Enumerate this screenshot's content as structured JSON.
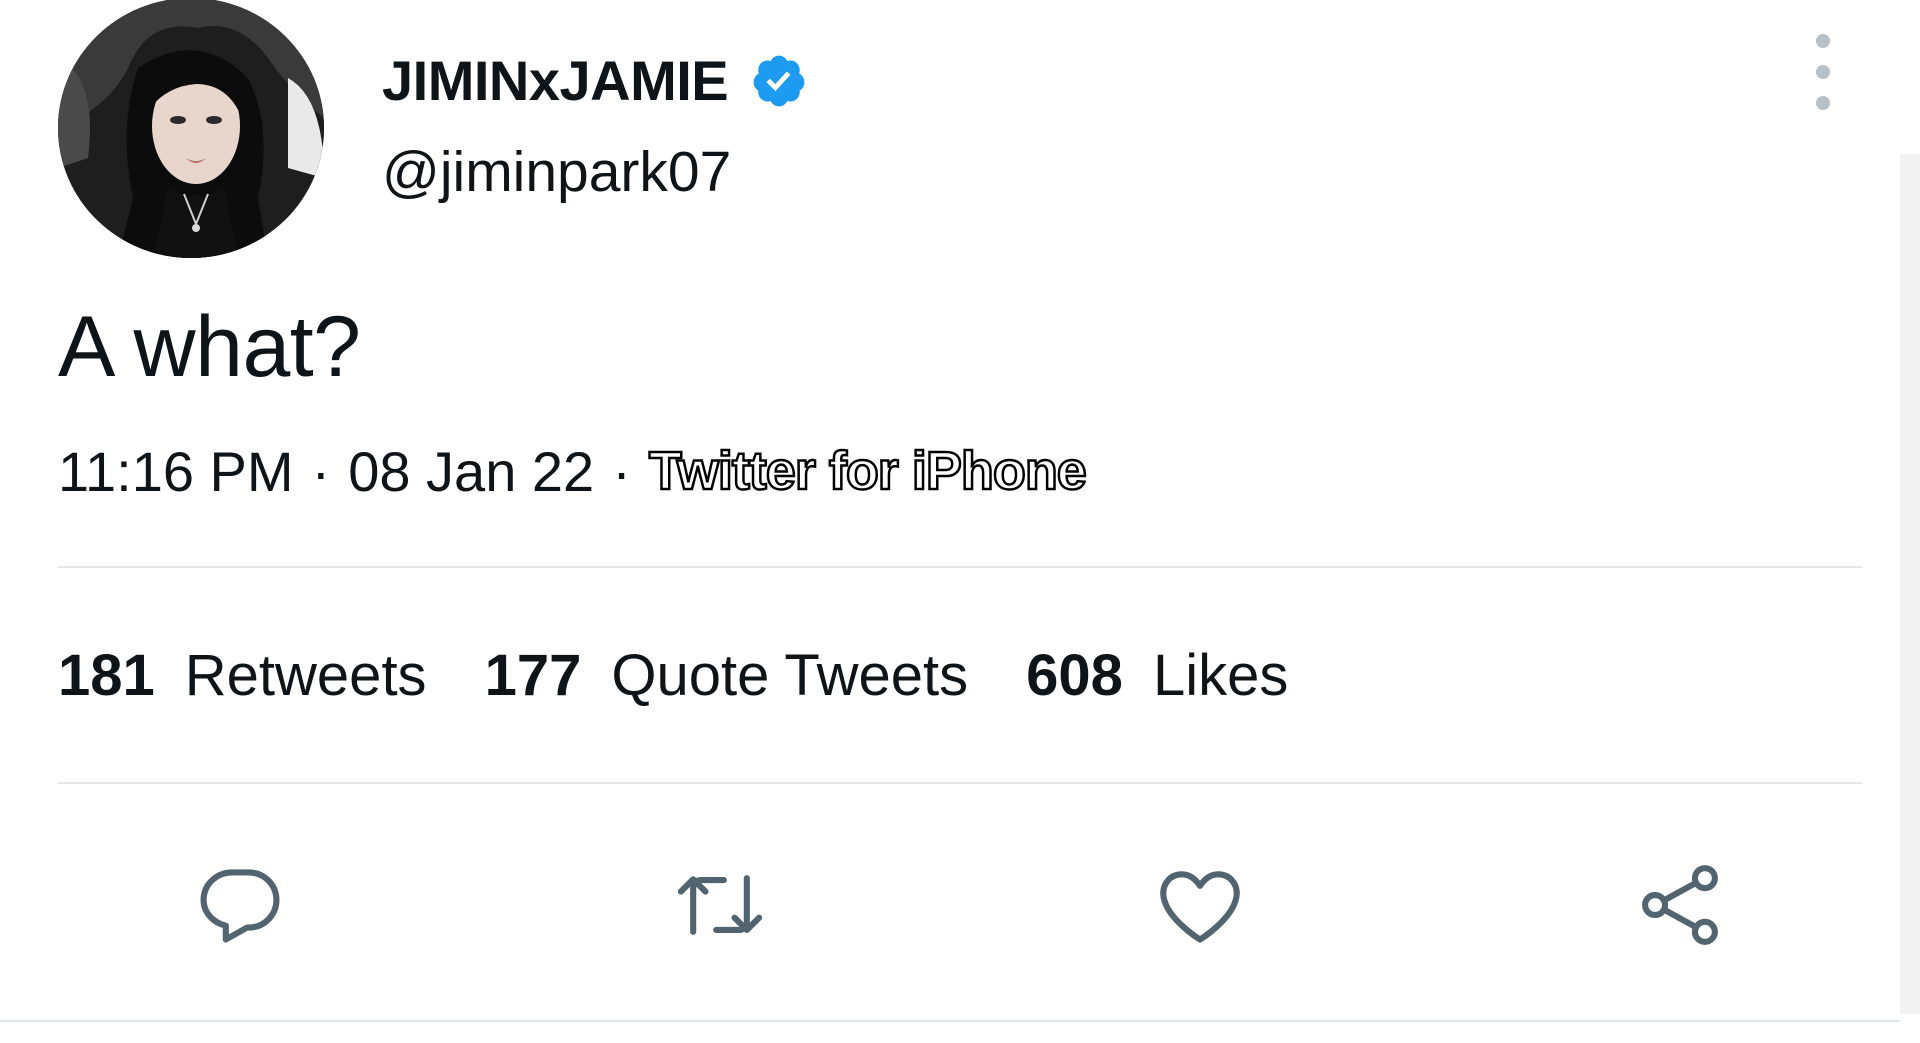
{
  "user": {
    "display_name": "JIMINxJAMIE",
    "handle": "@jiminpark07",
    "verified": true,
    "verified_color": "#1d9bf0"
  },
  "tweet": {
    "text": "A what?",
    "time": "11:16 PM",
    "date": "08 Jan 22",
    "separator": "·",
    "source": "Twitter for iPhone"
  },
  "stats": [
    {
      "count": "181",
      "label": "Retweets"
    },
    {
      "count": "177",
      "label": "Quote Tweets"
    },
    {
      "count": "608",
      "label": "Likes"
    }
  ],
  "actions": {
    "icons": [
      "reply-icon",
      "retweet-icon",
      "like-icon",
      "share-icon"
    ],
    "icon_color": "#536471"
  },
  "menu": {
    "icon": "more-vertical-icon"
  }
}
